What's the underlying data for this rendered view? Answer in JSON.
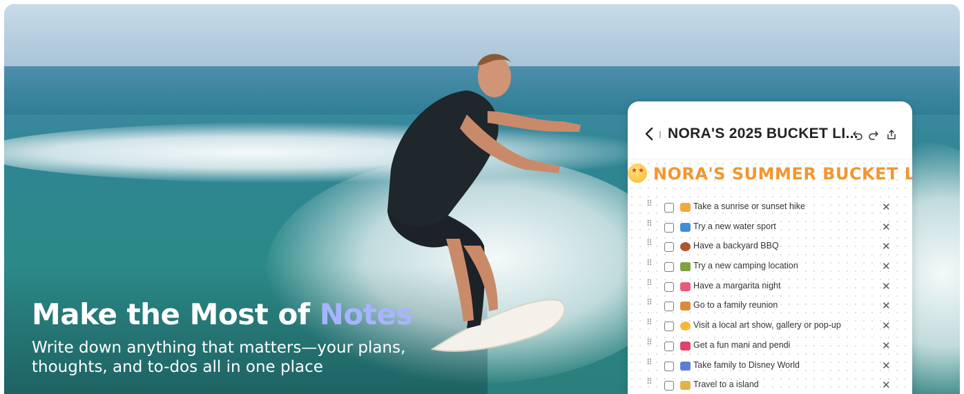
{
  "hero": {
    "headline_main": "Make the Most of ",
    "headline_accent": "Notes",
    "subline": "Write down anything that matters—your plans, thoughts, and to-dos all in one place"
  },
  "notes_card": {
    "title": "NORA'S 2025 BUCKET LI...",
    "list_title": "NORA'S SUMMER BUCKET LIST",
    "icons": [
      "back-icon",
      "undo-icon",
      "redo-icon",
      "share-icon"
    ],
    "items": [
      {
        "text": "Take a sunrise or sunset hike",
        "icon": "sunrise-icon",
        "color": "#f4a83a"
      },
      {
        "text": "Try a new water sport",
        "icon": "surfer-icon",
        "color": "#3f8fd8"
      },
      {
        "text": "Have a backyard BBQ",
        "icon": "meat-icon",
        "color": "#b0562d"
      },
      {
        "text": "Try a new camping location",
        "icon": "camping-icon",
        "color": "#7ea33f"
      },
      {
        "text": "Have a margarita night",
        "icon": "cocktail-icon",
        "color": "#e85a7a"
      },
      {
        "text": "Go to a family reunion",
        "icon": "house-icon",
        "color": "#d98c3c"
      },
      {
        "text": "Visit a local art show, gallery or pop-up",
        "icon": "smiling-face-icon",
        "color": "#f5b93a"
      },
      {
        "text": "Get a fun mani and pendi",
        "icon": "nail-polish-icon",
        "color": "#e0446b"
      },
      {
        "text": "Take family to Disney World",
        "icon": "carousel-icon",
        "color": "#5a7fd1"
      },
      {
        "text": "Travel to a island",
        "icon": "island-icon",
        "color": "#e4b24a"
      }
    ]
  }
}
